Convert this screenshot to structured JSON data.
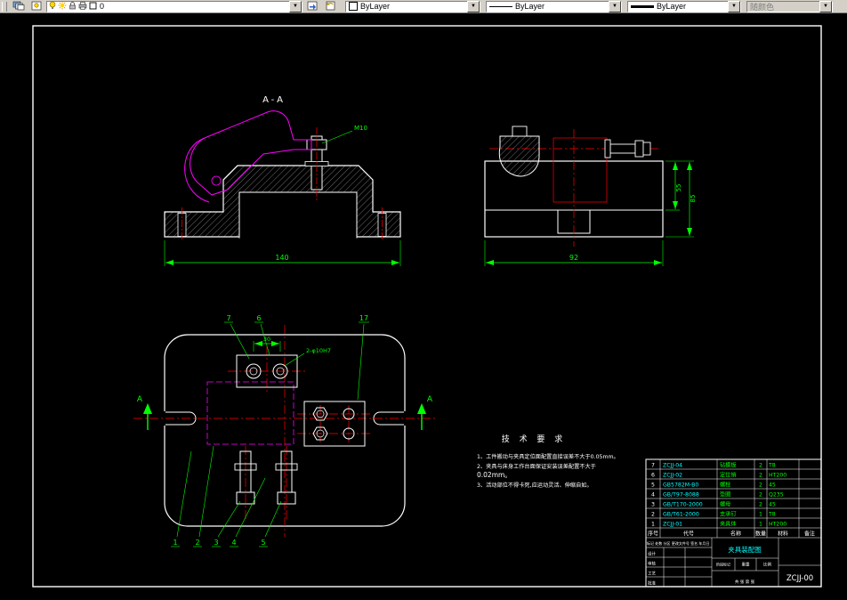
{
  "toolbar": {
    "layer": {
      "value": "0"
    },
    "color": {
      "value": "ByLayer"
    },
    "linetype": {
      "value": "ByLayer"
    },
    "lineweight": {
      "value": "ByLayer"
    },
    "plot_style": {
      "value": "随颜色"
    }
  },
  "colors": {
    "object": "#ffffff",
    "dimension": "#00ff00",
    "centerline": "#ff0000",
    "phantom": "#ff00ff",
    "accent": "#00ffff"
  },
  "drawing": {
    "section_view_label": "A-A",
    "section_marker": "A",
    "balloons": {
      "n1": "1",
      "n2": "2",
      "n3": "3",
      "n4": "4",
      "n5": "5",
      "n6": "6",
      "n7": "7",
      "n17": "17"
    },
    "dims": {
      "front_width": "140",
      "bolt": "M10",
      "right_h1": "55",
      "right_h2": "85",
      "right_width": "92",
      "plan_pitch": "30",
      "plan_holes": "2-φ10H7"
    },
    "tech": {
      "title": "技 术 要 求",
      "lines": [
        "1、工件搬动与夹具定位面配置直接误差不大于0.05mm。",
        "2、夹具与床身工作台面保证安装误差配置不大于",
        "0.02mm。",
        "3、活动部位不得卡死,应运动灵活、伸缩自如。"
      ]
    }
  },
  "bom": {
    "headers": [
      "序号",
      "代号",
      "名称",
      "数量",
      "材料",
      "备注"
    ],
    "rows": [
      {
        "no": "7",
        "code": "ZCJJ-04",
        "name": "钻模板",
        "qty": "2",
        "mat": "T8"
      },
      {
        "no": "6",
        "code": "ZCJJ-02",
        "name": "定位销",
        "qty": "2",
        "mat": "HT200"
      },
      {
        "no": "5",
        "code": "GB5782M-B0",
        "name": "螺栓",
        "qty": "2",
        "mat": "45"
      },
      {
        "no": "4",
        "code": "GB/T97-8088",
        "name": "垫圈",
        "qty": "2",
        "mat": "Q235"
      },
      {
        "no": "3",
        "code": "GB/T170-2000",
        "name": "螺母",
        "qty": "2",
        "mat": "45"
      },
      {
        "no": "2",
        "code": "GB/T61-2000",
        "name": "支承钉",
        "qty": "1",
        "mat": "T8"
      },
      {
        "no": "1",
        "code": "ZCJJ-01",
        "name": "夹具体",
        "qty": "1",
        "mat": "HT200"
      }
    ]
  },
  "title_block": {
    "drawing_name": "夹具装配图",
    "drawing_no": "ZCJJ-00",
    "labels": {
      "rev_row": "标记 处数 分区 更改文件号 签名 年月日",
      "design": "设计",
      "check": "审核",
      "process": "工艺",
      "approve": "批准",
      "stage": "阶段标记",
      "weight": "重量",
      "scale": "比例",
      "sheet_info": "共 张 第 张"
    }
  }
}
